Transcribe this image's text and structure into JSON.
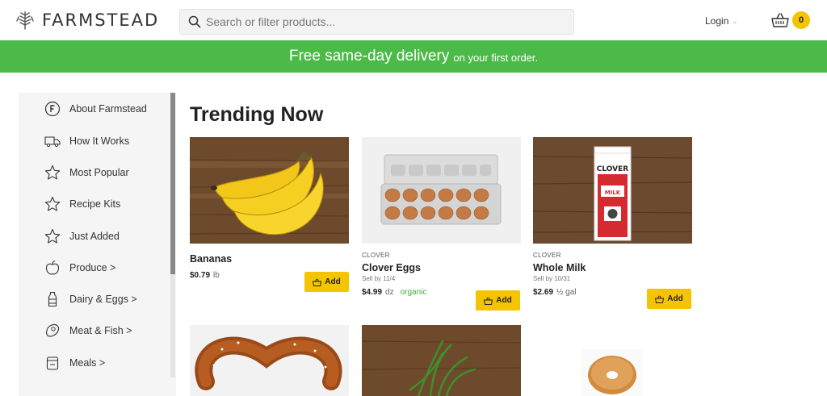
{
  "header": {
    "logo_text": "FARMSTEAD",
    "search_placeholder": "Search or filter products...",
    "login_label": "Login",
    "cart_count": "0"
  },
  "promo": {
    "main": "Free same-day delivery",
    "sub": "on your first order."
  },
  "sidebar": {
    "items": [
      {
        "label": "About Farmstead",
        "icon": "farmstead-f-icon"
      },
      {
        "label": "How It Works",
        "icon": "truck-icon"
      },
      {
        "label": "Most Popular",
        "icon": "star-icon"
      },
      {
        "label": "Recipe Kits",
        "icon": "star-icon"
      },
      {
        "label": "Just Added",
        "icon": "star-icon"
      },
      {
        "label": "Produce >",
        "icon": "apple-icon"
      },
      {
        "label": "Dairy & Eggs >",
        "icon": "milk-bottle-icon"
      },
      {
        "label": "Meat & Fish >",
        "icon": "steak-icon"
      },
      {
        "label": "Meals >",
        "icon": "container-icon"
      }
    ]
  },
  "main": {
    "title": "Trending Now",
    "add_label": "Add",
    "products": [
      {
        "brand": "",
        "name": "Bananas",
        "sell_by": "",
        "price": "$0.79",
        "unit": "lb",
        "tag": ""
      },
      {
        "brand": "CLOVER",
        "name": "Clover Eggs",
        "sell_by": "Sell by 11/4",
        "price": "$4.99",
        "unit": "dz",
        "tag": "organic"
      },
      {
        "brand": "CLOVER",
        "name": "Whole Milk",
        "sell_by": "Sell by 10/31",
        "price": "$2.69",
        "unit": "½ gal",
        "tag": ""
      }
    ]
  },
  "colors": {
    "brand_green": "#4cba48",
    "accent_yellow": "#f5c400"
  }
}
